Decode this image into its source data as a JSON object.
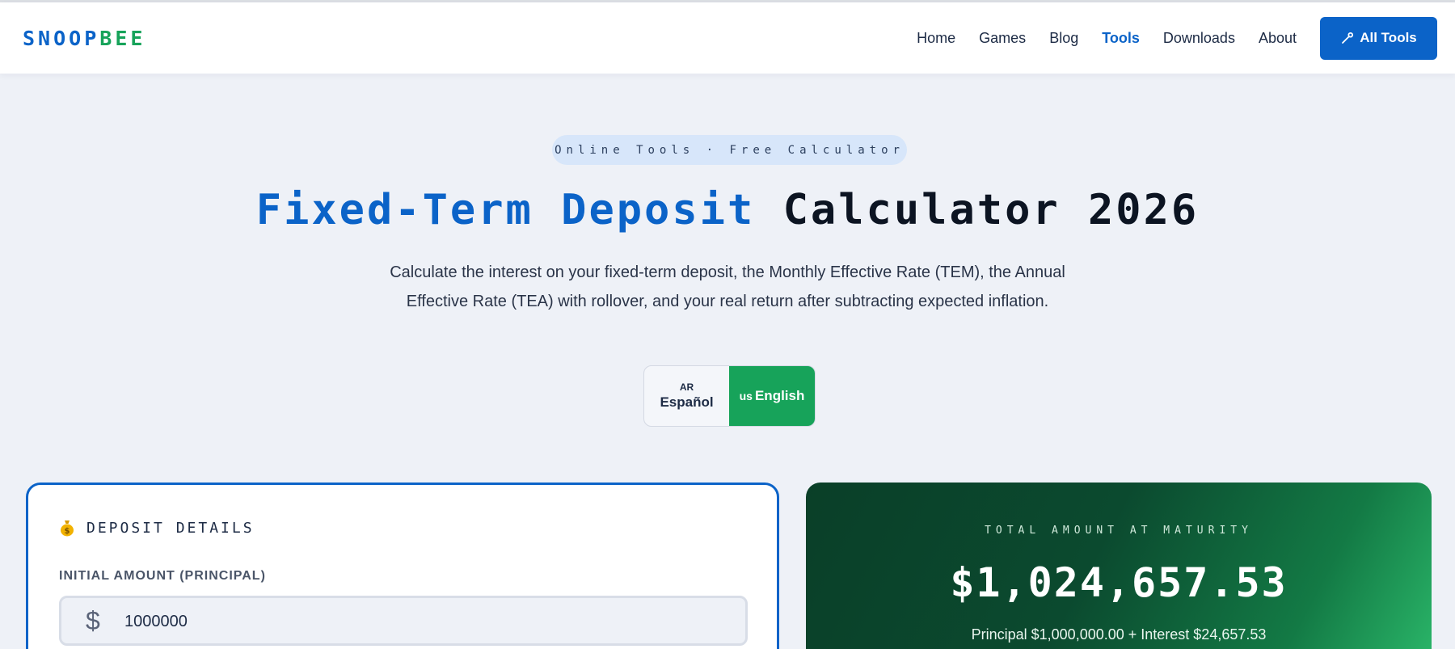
{
  "brand": {
    "part1": "SNOOP",
    "part2": "BEE"
  },
  "nav": {
    "links": [
      "Home",
      "Games",
      "Blog",
      "Tools",
      "Downloads",
      "About"
    ],
    "active": "Tools",
    "cta_label": "All Tools",
    "cta_icon": "wrench-icon"
  },
  "hero": {
    "pill": "Online Tools · Free Calculator",
    "title_highlight": "Fixed-Term Deposit",
    "title_rest": "Calculator 2026",
    "subtitle": "Calculate the interest on your fixed-term deposit, the Monthly Effective Rate (TEM), the Annual Effective Rate (TEA) with rollover, and your real return after subtracting expected inflation."
  },
  "language": {
    "spanish": {
      "code": "AR",
      "label": "Español"
    },
    "english": {
      "code": "us",
      "label": "English"
    },
    "selected": "English"
  },
  "deposit": {
    "section_title": "DEPOSIT DETAILS",
    "section_icon": "money-bag-icon",
    "initial_amount_label": "INITIAL AMOUNT (PRINCIPAL)",
    "currency_symbol": "$",
    "initial_amount_value": "1000000"
  },
  "result": {
    "label": "TOTAL AMOUNT AT MATURITY",
    "total": "$1,024,657.53",
    "breakdown": "Principal $1,000,000.00 + Interest $24,657.53"
  },
  "colors": {
    "primary": "#0b63c8",
    "brand_green": "#17a35a",
    "result_dark_green": "#0a3f28"
  }
}
